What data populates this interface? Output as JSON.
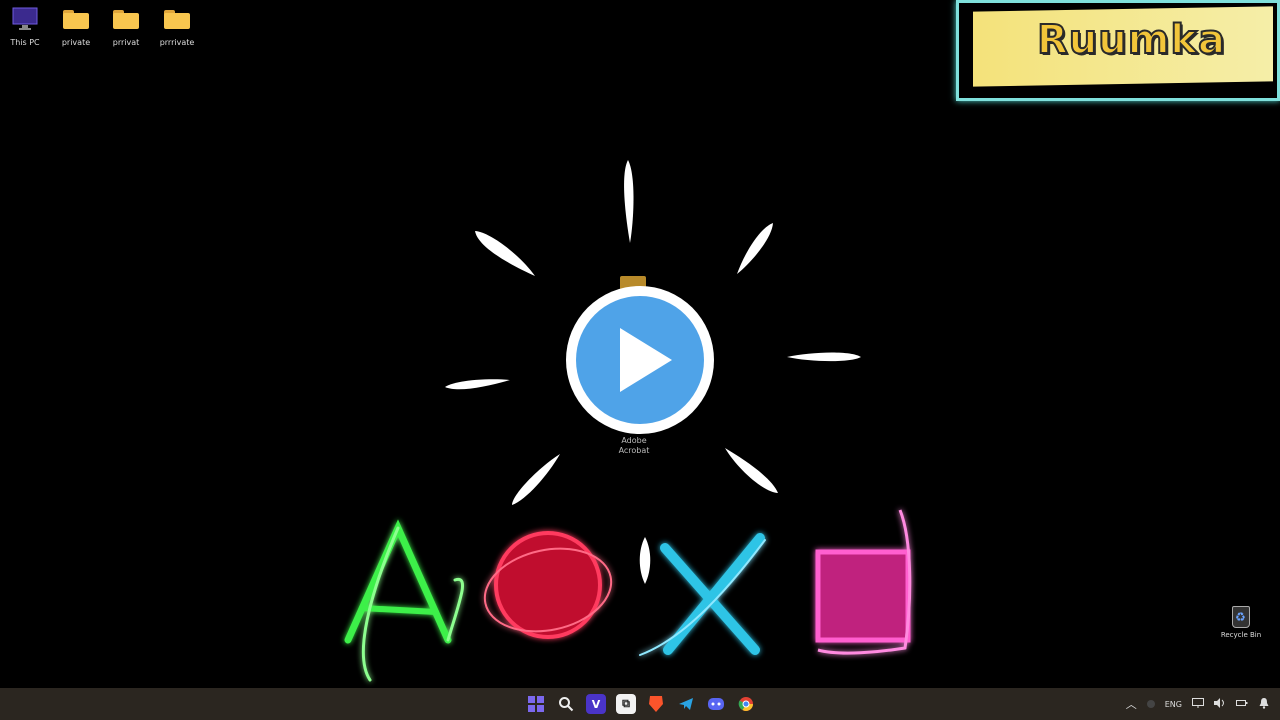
{
  "desktop": {
    "icons": [
      {
        "label": "This PC",
        "icon": "monitor-icon"
      },
      {
        "label": "private",
        "icon": "folder-icon"
      },
      {
        "label": "prrivat",
        "icon": "folder-icon"
      },
      {
        "label": "prrrivate",
        "icon": "folder-icon"
      }
    ],
    "center_icon_label_line1": "Adobe",
    "center_icon_label_line2": "Acrobat",
    "recycle_bin_label": "Recycle Bin"
  },
  "overlay": {
    "brand_text": "Ruumka",
    "play_button": "play-icon"
  },
  "taskbar": {
    "apps": [
      {
        "name": "start-icon",
        "glyph": "",
        "color": "#6b5be8"
      },
      {
        "name": "search-icon",
        "glyph": "⌕",
        "color": "#e9e9e9"
      },
      {
        "name": "vpn-app-icon",
        "glyph": "V",
        "color": "#6a4cff"
      },
      {
        "name": "app-icon",
        "glyph": "⧉",
        "color": "#ffffff"
      },
      {
        "name": "brave-icon",
        "glyph": "◆",
        "color": "#fb542b"
      },
      {
        "name": "telegram-icon",
        "glyph": "➤",
        "color": "#2aa3e3"
      },
      {
        "name": "discord-icon",
        "glyph": "◉",
        "color": "#5865f2"
      },
      {
        "name": "chrome-icon",
        "glyph": "●",
        "color": "#e34133"
      }
    ],
    "tray": {
      "chevron": "^",
      "language": "ENG",
      "icons": [
        "network-icon",
        "volume-icon",
        "battery-icon",
        "notification-icon"
      ]
    }
  },
  "colors": {
    "brand_border": "#7fe0dc",
    "brand_fill": "#f4e27a",
    "play_disc": "#4fa3e8"
  }
}
